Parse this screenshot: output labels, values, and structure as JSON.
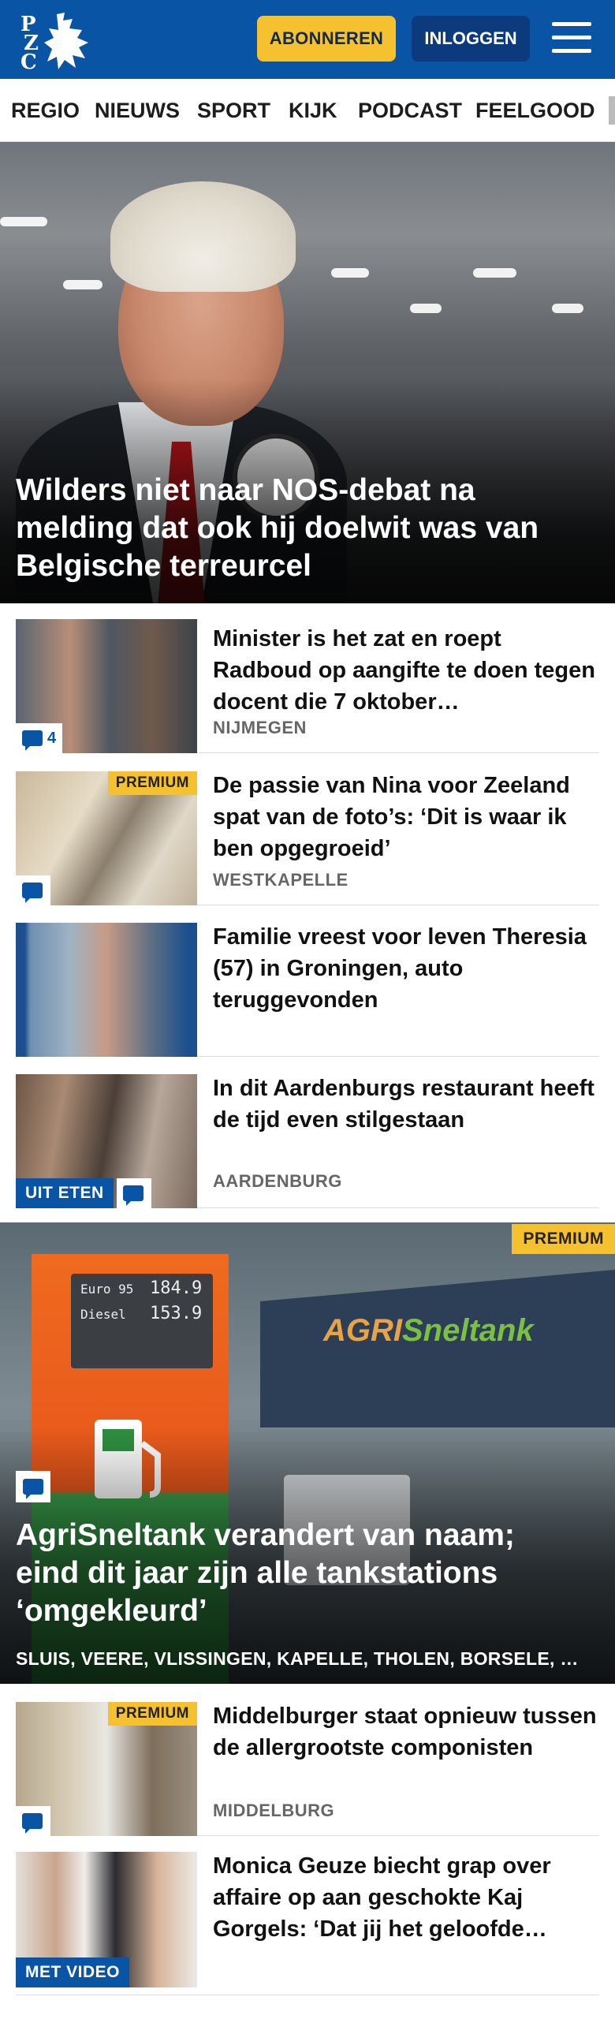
{
  "header": {
    "logo_letters": [
      "P",
      "Z",
      "C"
    ],
    "subscribe_label": "ABONNEREN",
    "login_label": "INLOGGEN",
    "menu_icon": "hamburger-icon",
    "background": "#0a54a5"
  },
  "nav": {
    "items": [
      "REGIO",
      "NIEUWS",
      "SPORT",
      "KIJK",
      "PODCAST",
      "FEELGOOD"
    ]
  },
  "hero": {
    "title": "Wilders niet naar NOS-debat na melding dat ook hij doelwit was van Belgische terreurcel"
  },
  "articles": [
    {
      "title": "Minister is het zat en roept Radboud op aangifte te doen tegen docent die 7 oktober…",
      "location": "NIJMEGEN",
      "comments": "4",
      "premium": ""
    },
    {
      "title": "De passie van Nina voor Zeeland spat van de foto’s: ‘Dit is waar ik ben opgegroeid’",
      "location": "WESTKAPELLE",
      "comments": "",
      "premium": "PREMIUM"
    },
    {
      "title": "Familie vreest voor leven Theresia (57) in Groningen, auto teruggevonden",
      "location": "",
      "comments": "",
      "premium": ""
    },
    {
      "title": "In dit Aardenburgs restaurant heeft de tijd even stilgestaan",
      "location": "AARDENBURG",
      "tag": "UIT ETEN",
      "comments": "",
      "premium": ""
    }
  ],
  "feature": {
    "premium": "PREMIUM",
    "title": "AgriSneltank verandert van naam; eind dit jaar zijn alle tankstations ‘omgekleurd’",
    "locations": "SLUIS, VEERE, VLISSINGEN, KAPELLE, THOLEN, BORSELE, …",
    "pump_prices": [
      "Euro 95",
      "184.9",
      "Diesel",
      "153.9"
    ],
    "canopy_brand": [
      "AGRI",
      "Sneltank"
    ]
  },
  "articles2": [
    {
      "title": "Middelburger staat opnieuw tussen de allergrootste componisten",
      "location": "MIDDELBURG",
      "premium": "PREMIUM"
    },
    {
      "title": "Monica Geuze biecht grap over affaire op aan geschokte Kaj Gorgels: ‘Dat jij het geloofde…",
      "tag": "MET VIDEO"
    }
  ],
  "colors": {
    "brand_blue": "#0a54a5",
    "premium_yellow": "#f6c12e",
    "subscribe_yellow": "#f6c12e"
  }
}
